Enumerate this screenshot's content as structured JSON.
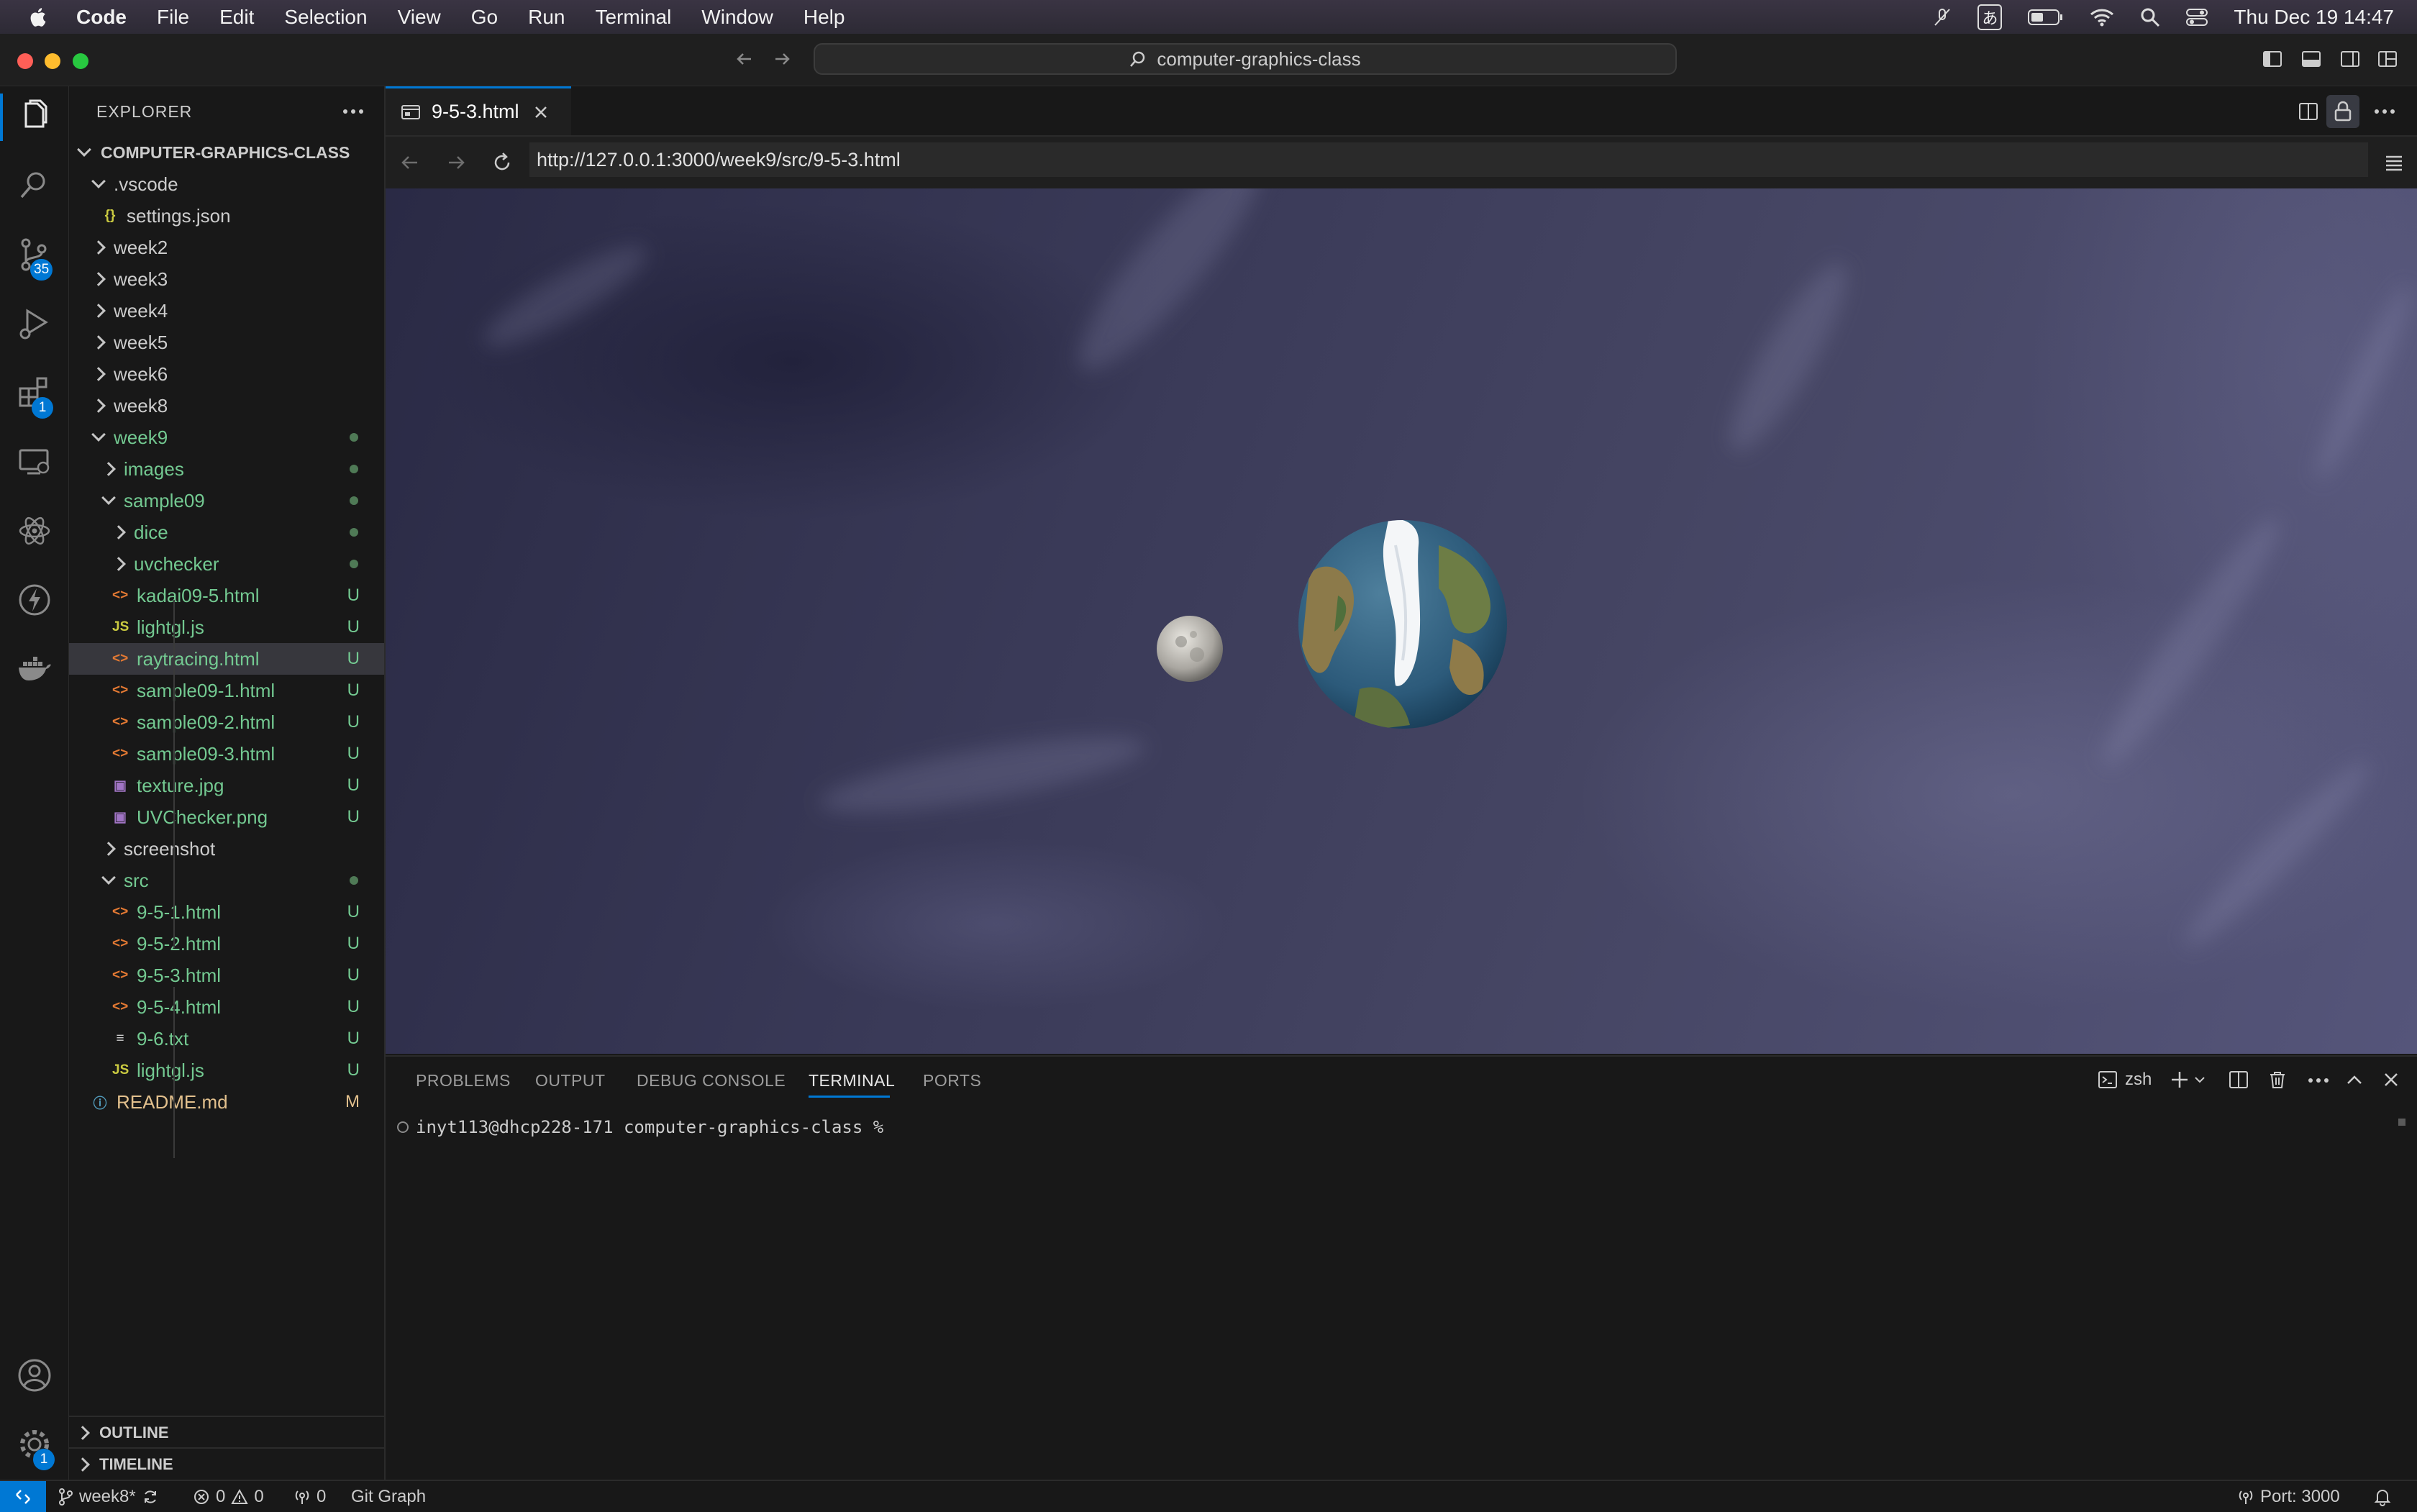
{
  "menubar": {
    "app_name": "Code",
    "items": [
      "File",
      "Edit",
      "Selection",
      "View",
      "Go",
      "Run",
      "Terminal",
      "Window",
      "Help"
    ],
    "ime_label": "あ",
    "clock": "Thu Dec 19  14:47"
  },
  "titlebar": {
    "command_center": "computer-graphics-class"
  },
  "activity": {
    "scm_badge": "35",
    "extensions_badge": "1",
    "settings_badge": "1"
  },
  "explorer": {
    "title": "EXPLORER",
    "root": "COMPUTER-GRAPHICS-CLASS",
    "rows": [
      {
        "label": ".vscode",
        "depth": 1,
        "kind": "folder",
        "open": true
      },
      {
        "label": "settings.json",
        "depth": 2,
        "kind": "json"
      },
      {
        "label": "week2",
        "depth": 1,
        "kind": "folder",
        "open": false
      },
      {
        "label": "week3",
        "depth": 1,
        "kind": "folder",
        "open": false
      },
      {
        "label": "week4",
        "depth": 1,
        "kind": "folder",
        "open": false
      },
      {
        "label": "week5",
        "depth": 1,
        "kind": "folder",
        "open": false
      },
      {
        "label": "week6",
        "depth": 1,
        "kind": "folder",
        "open": false
      },
      {
        "label": "week8",
        "depth": 1,
        "kind": "folder",
        "open": false
      },
      {
        "label": "week9",
        "depth": 1,
        "kind": "folder",
        "open": true,
        "dot": true,
        "color": "u"
      },
      {
        "label": "images",
        "depth": 2,
        "kind": "folder",
        "open": false,
        "dot": true,
        "color": "u"
      },
      {
        "label": "sample09",
        "depth": 2,
        "kind": "folder",
        "open": true,
        "dot": true,
        "color": "u"
      },
      {
        "label": "dice",
        "depth": 3,
        "kind": "folder",
        "open": false,
        "dot": true,
        "color": "u"
      },
      {
        "label": "uvchecker",
        "depth": 3,
        "kind": "folder",
        "open": false,
        "dot": true,
        "color": "u"
      },
      {
        "label": "kadai09-5.html",
        "depth": 3,
        "kind": "html",
        "decor": "U",
        "color": "u"
      },
      {
        "label": "lightgl.js",
        "depth": 3,
        "kind": "js",
        "decor": "U",
        "color": "u"
      },
      {
        "label": "raytracing.html",
        "depth": 3,
        "kind": "html",
        "decor": "U",
        "color": "u",
        "selected": true
      },
      {
        "label": "sample09-1.html",
        "depth": 3,
        "kind": "html",
        "decor": "U",
        "color": "u"
      },
      {
        "label": "sample09-2.html",
        "depth": 3,
        "kind": "html",
        "decor": "U",
        "color": "u"
      },
      {
        "label": "sample09-3.html",
        "depth": 3,
        "kind": "html",
        "decor": "U",
        "color": "u"
      },
      {
        "label": "texture.jpg",
        "depth": 3,
        "kind": "image",
        "decor": "U",
        "color": "u"
      },
      {
        "label": "UVChecker.png",
        "depth": 3,
        "kind": "image",
        "decor": "U",
        "color": "u"
      },
      {
        "label": "screenshot",
        "depth": 2,
        "kind": "folder",
        "open": false
      },
      {
        "label": "src",
        "depth": 2,
        "kind": "folder",
        "open": true,
        "dot": true,
        "color": "u"
      },
      {
        "label": "9-5-1.html",
        "depth": 3,
        "kind": "html",
        "decor": "U",
        "color": "u"
      },
      {
        "label": "9-5-2.html",
        "depth": 3,
        "kind": "html",
        "decor": "U",
        "color": "u"
      },
      {
        "label": "9-5-3.html",
        "depth": 3,
        "kind": "html",
        "decor": "U",
        "color": "u"
      },
      {
        "label": "9-5-4.html",
        "depth": 3,
        "kind": "html",
        "decor": "U",
        "color": "u"
      },
      {
        "label": "9-6.txt",
        "depth": 3,
        "kind": "text",
        "decor": "U",
        "color": "u"
      },
      {
        "label": "lightgl.js",
        "depth": 3,
        "kind": "js",
        "decor": "U",
        "color": "u"
      },
      {
        "label": "README.md",
        "depth": 1,
        "kind": "info",
        "decor": "M",
        "color": "m"
      }
    ],
    "outline_label": "OUTLINE",
    "timeline_label": "TIMELINE"
  },
  "editor": {
    "tab_label": "9-5-3.html",
    "url": "http://127.0.0.1:3000/week9/src/9-5-3.html"
  },
  "panel": {
    "tabs": [
      "PROBLEMS",
      "OUTPUT",
      "DEBUG CONSOLE",
      "TERMINAL",
      "PORTS"
    ],
    "active_tab": "TERMINAL",
    "shell_label": "zsh",
    "prompt": "inyt113@dhcp228-171 computer-graphics-class %"
  },
  "statusbar": {
    "branch": "week8*",
    "errors": "0",
    "warnings": "0",
    "ports": "0",
    "git_graph": "Git Graph",
    "port_label": "Port: 3000"
  },
  "colors": {
    "accent": "#0078d4",
    "untracked": "#73c991",
    "modified": "#e2c08d"
  }
}
